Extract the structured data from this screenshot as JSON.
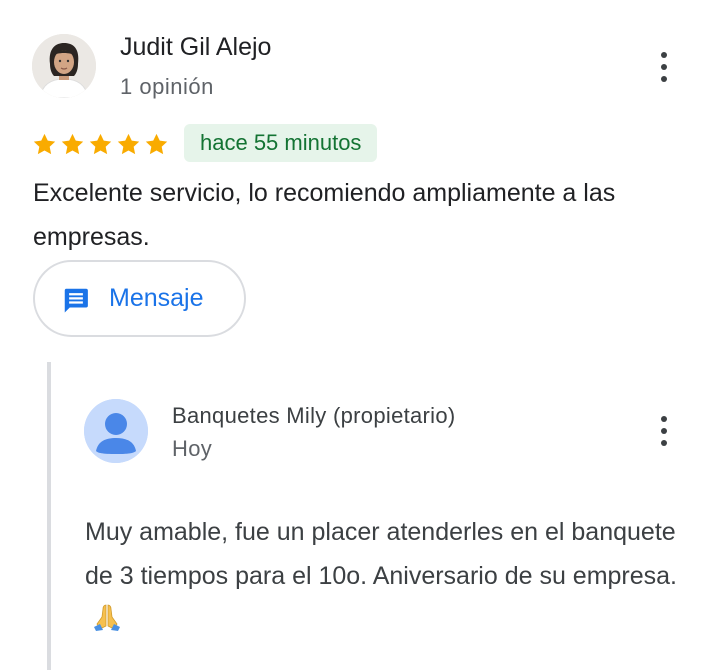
{
  "review": {
    "author": {
      "name": "Judit Gil Alejo",
      "meta": "1 opinión"
    },
    "rating": 5,
    "time": "hace 55 minutos",
    "text": "Excelente servicio, lo recomiendo ampliamente a las empresas.",
    "message_button": {
      "label": "Mensaje",
      "icon": "message-icon"
    },
    "menu_icon": "more-vert-icon"
  },
  "owner_reply": {
    "name": "Banquetes Mily (propietario)",
    "time": "Hoy",
    "text": "Muy amable, fue un placer atenderles en el banquete de 3 tiempos para el 10o. Aniversario de su empresa.",
    "emoji_icon": "folded-hands-icon",
    "menu_icon": "more-vert-icon"
  },
  "colors": {
    "star": "#f9ab00",
    "chip_bg": "#e6f4ea",
    "chip_text": "#137333",
    "link_blue": "#1a73e8",
    "owner_avatar_bg": "#c6dafc",
    "owner_avatar_fg": "#4a87e8"
  }
}
